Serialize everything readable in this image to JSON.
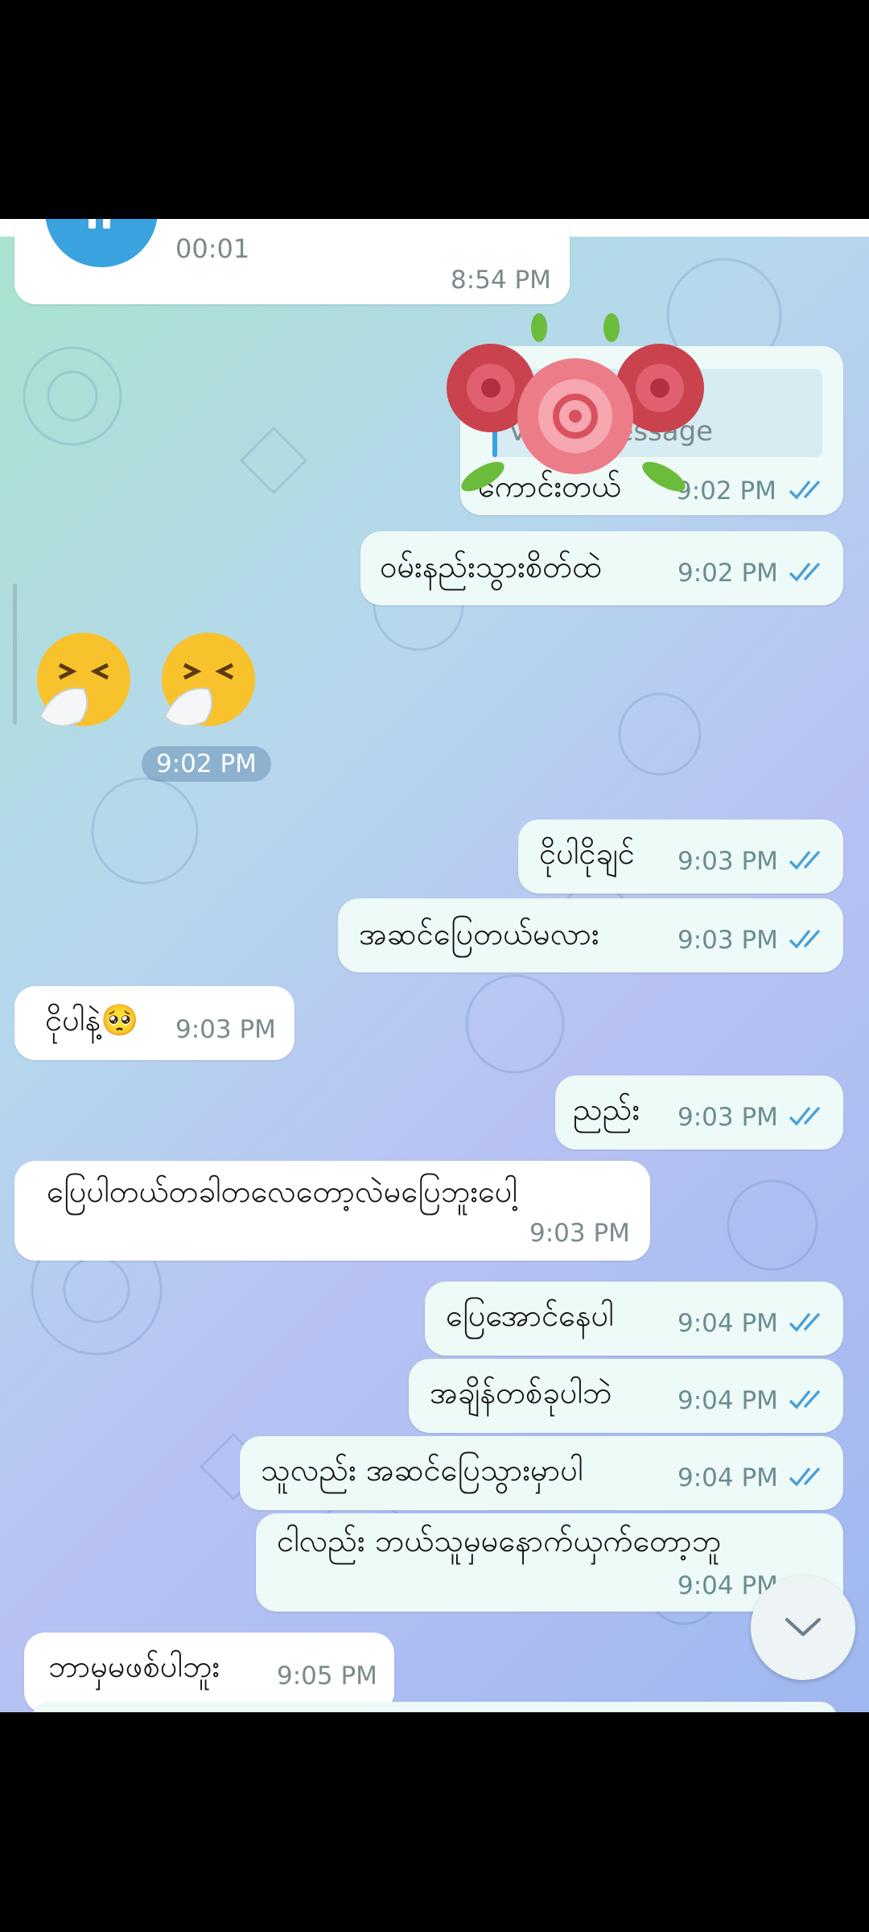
{
  "colors": {
    "accent": "#3aa2df",
    "check": "#4a9fd8"
  },
  "voice": {
    "duration": "00:01",
    "time": "8:54 PM"
  },
  "sticker": {
    "name": "rose-bouquet-sticker"
  },
  "reply_preview": {
    "text": "Voice message"
  },
  "messages": [
    {
      "dir": "out",
      "text": "ကောင်းတယ်",
      "time": "9:02 PM",
      "read": true
    },
    {
      "dir": "out",
      "text": "ဝမ်းနည်းသွားစိတ်ထဲ",
      "time": "9:02 PM",
      "read": true
    },
    {
      "dir": "in",
      "emoji": [
        "sneezing-face-emoji",
        "sneezing-face-emoji"
      ],
      "time": "9:02 PM"
    },
    {
      "dir": "out",
      "text": "ငိုပါငိုချင်",
      "time": "9:03 PM",
      "read": true
    },
    {
      "dir": "out",
      "text": "အဆင်ပြေတယ်မလား",
      "time": "9:03 PM",
      "read": true
    },
    {
      "dir": "in",
      "text": "ငိုပါနဲ့🥺",
      "time": "9:03 PM"
    },
    {
      "dir": "out",
      "text": "ညည်း",
      "time": "9:03 PM",
      "read": true
    },
    {
      "dir": "in",
      "text": "ပြေပါတယ်တခါတလေတော့လဲမပြေဘူးပေါ့",
      "time": "9:03 PM"
    },
    {
      "dir": "out",
      "text": "ပြေအောင်နေပါ",
      "time": "9:04 PM",
      "read": true
    },
    {
      "dir": "out",
      "text": "အချိန်တစ်ခုပါဘဲ",
      "time": "9:04 PM",
      "read": true
    },
    {
      "dir": "out",
      "text": "သူလည်း အဆင်ပြေသွားမှာပါ",
      "time": "9:04 PM",
      "read": true
    },
    {
      "dir": "out",
      "text": "ငါလည်း ဘယ်သူမှမနောက်ယှက်တော့ဘူ",
      "time": "9:04 PM",
      "read": true
    },
    {
      "dir": "in",
      "text": "ဘာမှမဖစ်ပါဘူး",
      "time": "9:05 PM"
    }
  ],
  "scroll_down": {
    "icon": "chevron-down-icon"
  }
}
